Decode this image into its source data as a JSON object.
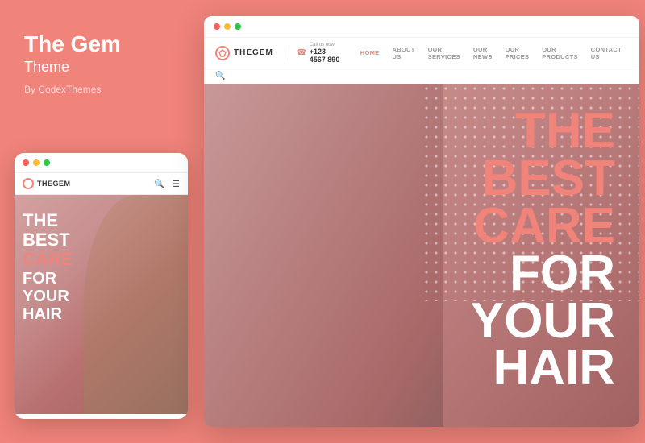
{
  "left": {
    "title": "The Gem",
    "subtitle": "Theme",
    "by": "By CodexThemes"
  },
  "mobile": {
    "dots": [
      "red",
      "yellow",
      "green"
    ],
    "logo": "THEGEM",
    "hero_lines": [
      {
        "text": "THE",
        "color": "white"
      },
      {
        "text": "BEST",
        "color": "white"
      },
      {
        "text": "CARE",
        "color": "salmon"
      },
      {
        "text": "FOR",
        "color": "white"
      },
      {
        "text": "YOUR",
        "color": "white"
      },
      {
        "text": "HAIR",
        "color": "white"
      }
    ]
  },
  "desktop": {
    "logo": "THEGEM",
    "phone_label": "Call us now",
    "phone_number": "+123 4567 890",
    "nav_links": [
      {
        "label": "HOME",
        "active": true
      },
      {
        "label": "ABOUT US",
        "active": false
      },
      {
        "label": "OUR SERVICES",
        "active": false
      },
      {
        "label": "OUR NEWS",
        "active": false
      },
      {
        "label": "OUR PRICES",
        "active": false
      },
      {
        "label": "OUR PRODUCTS",
        "active": false
      },
      {
        "label": "CONTACT US",
        "active": false
      }
    ],
    "hero_lines": [
      {
        "text": "THE",
        "color": "salmon"
      },
      {
        "text": "BEST",
        "color": "salmon"
      },
      {
        "text": "CARE",
        "color": "salmon"
      },
      {
        "text": "FOR",
        "color": "white"
      },
      {
        "text": "YOUR",
        "color": "white"
      },
      {
        "text": "HAIR",
        "color": "white"
      }
    ]
  },
  "colors": {
    "salmon": "#f0837a",
    "background": "#f0837a"
  }
}
